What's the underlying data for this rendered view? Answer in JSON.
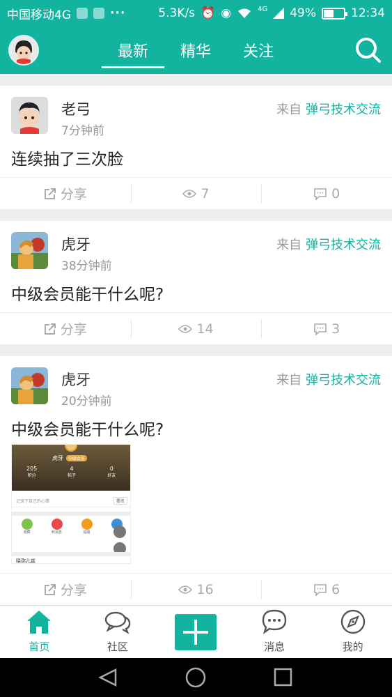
{
  "status_bar": {
    "carrier": "中国移动4G",
    "speed": "5.3K/s",
    "network": "4G",
    "battery": "49%",
    "battery_level": 0.49,
    "time": "12:34"
  },
  "header": {
    "tabs": [
      {
        "label": "最新",
        "active": true
      },
      {
        "label": "精华",
        "active": false
      },
      {
        "label": "关注",
        "active": false
      }
    ],
    "search_icon": "search-icon"
  },
  "posts": [
    {
      "username": "老弓",
      "time": "7分钟前",
      "source_prefix": "来自",
      "source_group": "弹弓技术交流",
      "title": "连续抽了三次脸",
      "share_label": "分享",
      "views": "7",
      "comments": "0",
      "avatar": "boy-avatar"
    },
    {
      "username": "虎牙",
      "time": "38分钟前",
      "source_prefix": "来自",
      "source_group": "弹弓技术交流",
      "title": "中级会员能干什么呢?",
      "share_label": "分享",
      "views": "14",
      "comments": "3",
      "avatar": "archer-avatar"
    },
    {
      "username": "虎牙",
      "time": "20分钟前",
      "source_prefix": "来自",
      "source_group": "弹弓技术交流",
      "title": "中级会员能干什么呢?",
      "share_label": "分享",
      "views": "16",
      "comments": "6",
      "avatar": "archer-avatar",
      "thumbnail": {
        "name": "虎牙",
        "badge": "中级会员",
        "stats": [
          {
            "value": "205",
            "label": "积分"
          },
          {
            "value": "4",
            "label": "帖子"
          },
          {
            "value": "0",
            "label": "好友"
          }
        ],
        "mood_placeholder": "记录下自己的心情",
        "mood_button": "署名",
        "menu": [
          {
            "label": "收藏",
            "color": "#7cc24c"
          },
          {
            "label": "积消息",
            "color": "#e84b4b"
          },
          {
            "label": "提醒",
            "color": "#f39b1f"
          },
          {
            "label": "设置",
            "color": "#3a8fd6"
          }
        ],
        "footer_text": "晓弥儿兹"
      }
    }
  ],
  "bottom_nav": [
    {
      "label": "首页",
      "icon": "home-icon",
      "active": true
    },
    {
      "label": "社区",
      "icon": "chat-bubbles-icon",
      "active": false
    },
    {
      "label": "",
      "icon": "plus-icon",
      "active": false
    },
    {
      "label": "消息",
      "icon": "message-icon",
      "active": false
    },
    {
      "label": "我的",
      "icon": "compass-icon",
      "active": false
    }
  ],
  "colors": {
    "primary": "#12b4a0",
    "muted": "#999999"
  }
}
